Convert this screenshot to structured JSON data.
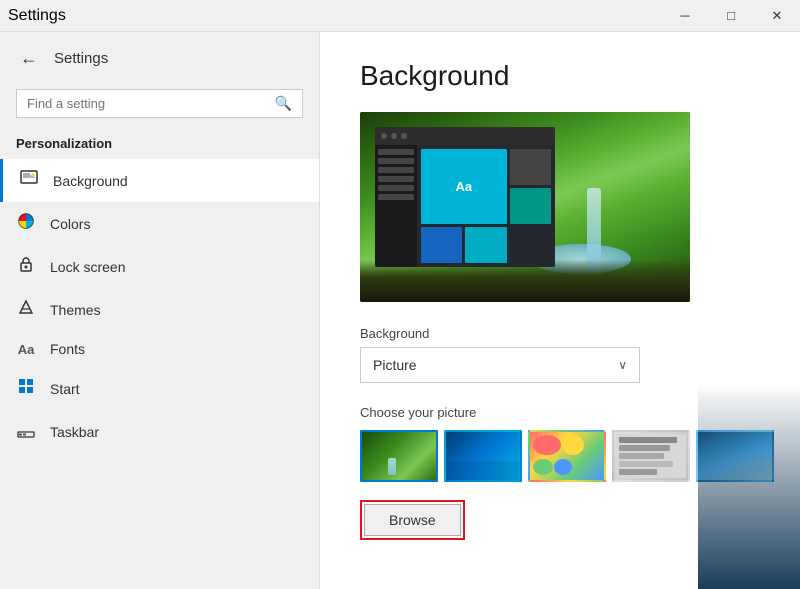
{
  "titlebar": {
    "title": "Settings",
    "minimize": "─",
    "maximize": "□",
    "close": "✕"
  },
  "sidebar": {
    "back_label": "←",
    "app_title": "Settings",
    "search_placeholder": "Find a setting",
    "section_label": "Personalization",
    "nav_items": [
      {
        "id": "background",
        "icon": "🖼",
        "label": "Background",
        "active": true
      },
      {
        "id": "colors",
        "icon": "🎨",
        "label": "Colors",
        "active": false
      },
      {
        "id": "lock_screen",
        "icon": "🔒",
        "label": "Lock screen",
        "active": false
      },
      {
        "id": "themes",
        "icon": "✏️",
        "label": "Themes",
        "active": false
      },
      {
        "id": "fonts",
        "icon": "Aa",
        "label": "Fonts",
        "active": false
      },
      {
        "id": "start",
        "icon": "⊞",
        "label": "Start",
        "active": false
      },
      {
        "id": "taskbar",
        "icon": "▬",
        "label": "Taskbar",
        "active": false
      }
    ]
  },
  "content": {
    "page_title": "Background",
    "background_label": "Background",
    "dropdown_value": "Picture",
    "dropdown_arrow": "∨",
    "choose_label": "Choose your picture",
    "browse_label": "Browse"
  }
}
